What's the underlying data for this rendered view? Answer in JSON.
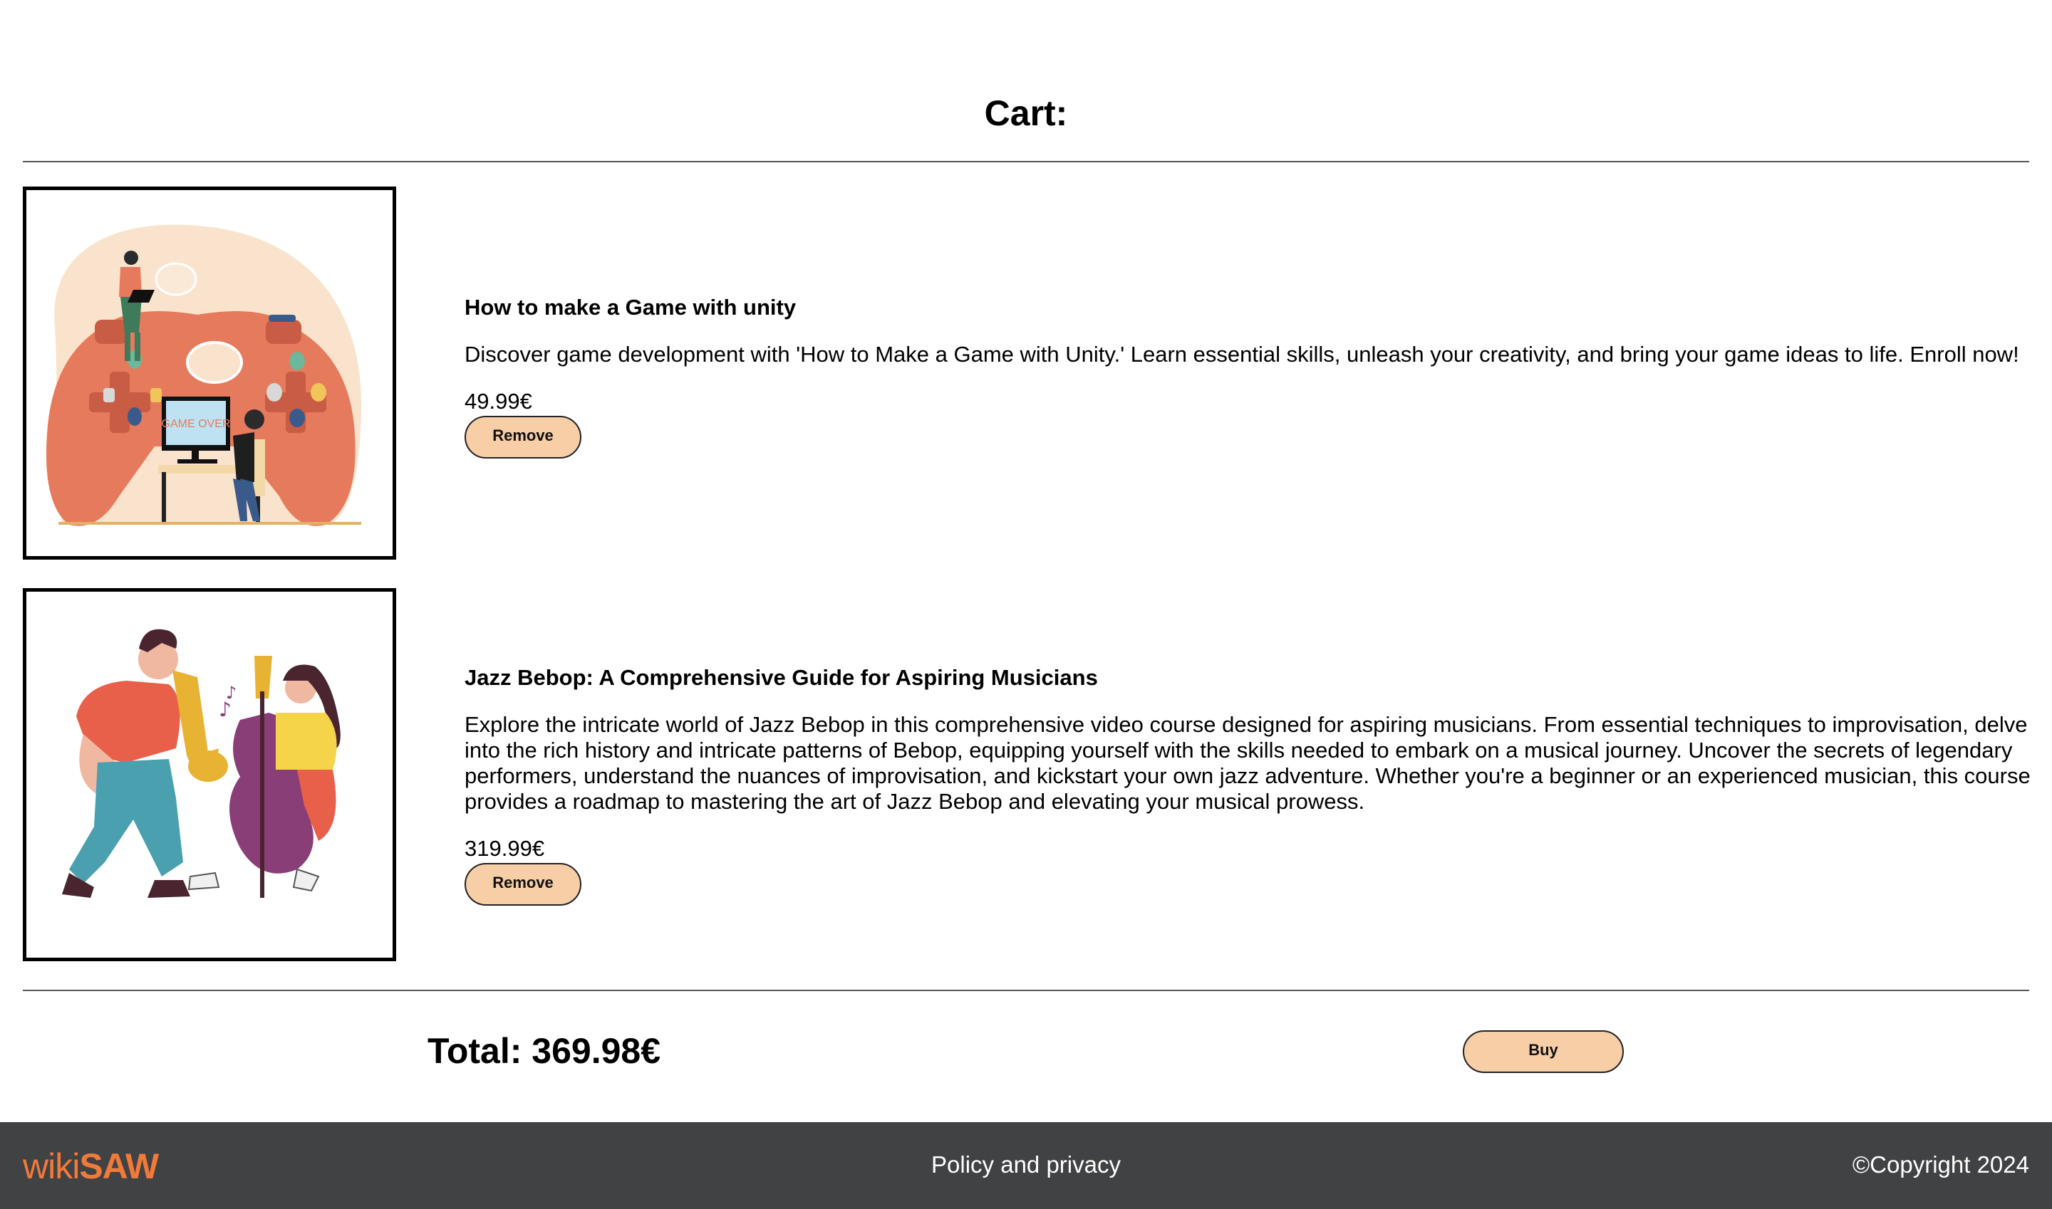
{
  "cart": {
    "title": "Cart:",
    "items": [
      {
        "title": "How to make a Game with unity",
        "description": "Discover game development with 'How to Make a Game with Unity.' Learn essential skills, unleash your creativity, and bring your game ideas to life. Enroll now!",
        "price": "49.99€",
        "remove_label": "Remove",
        "image_text": "GAME OVER",
        "image": "game-controller-illustration"
      },
      {
        "title": "Jazz Bebop: A Comprehensive Guide for Aspiring Musicians",
        "description": "Explore the intricate world of Jazz Bebop in this comprehensive video course designed for aspiring musicians. From essential techniques to improvisation, delve into the rich history and intricate patterns of Bebop, equipping yourself with the skills needed to embark on a musical journey. Uncover the secrets of legendary performers, understand the nuances of improvisation, and kickstart your own jazz adventure. Whether you're a beginner or an experienced musician, this course provides a roadmap to mastering the art of Jazz Bebop and elevating your musical prowess.",
        "price": "319.99€",
        "remove_label": "Remove",
        "image": "jazz-musicians-illustration"
      }
    ],
    "total": "Total: 369.98€",
    "buy_label": "Buy"
  },
  "footer": {
    "logo_prefix": "wiki",
    "logo_suffix": "SAW",
    "policy_link": "Policy and privacy",
    "copyright": "©Copyright 2024"
  },
  "colors": {
    "button_fill": "#f7cea6",
    "footer_bg": "#414244",
    "logo": "#f07a3a"
  }
}
